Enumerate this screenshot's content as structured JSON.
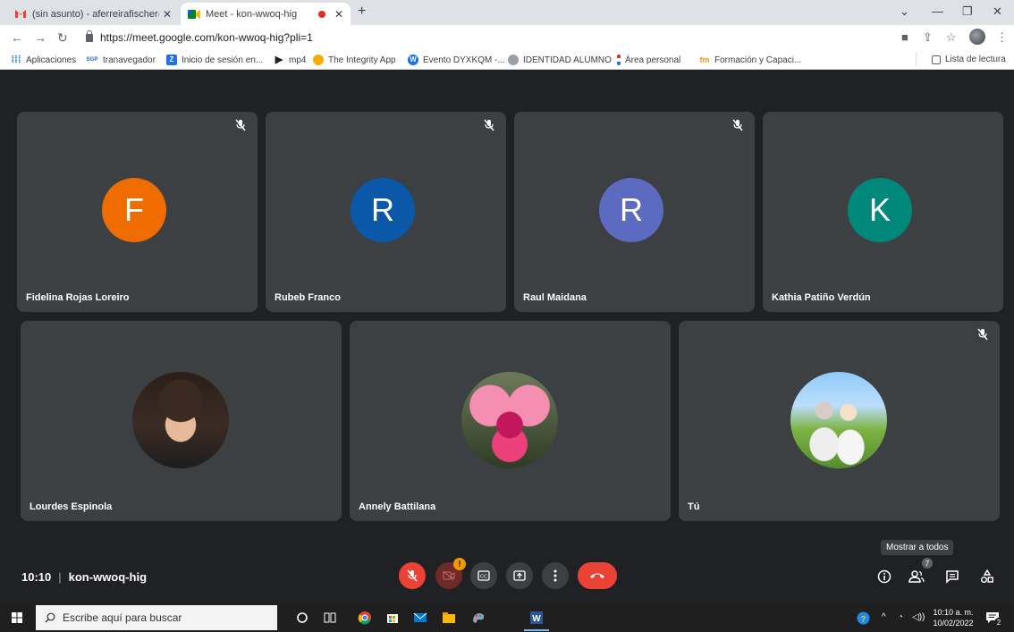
{
  "browser": {
    "tabs": [
      {
        "title": "(sin asunto) - aferreirafischer@gm"
      },
      {
        "title": "Meet - kon-wwoq-hig"
      }
    ],
    "url": "https://meet.google.com/kon-wwoq-hig?pli=1",
    "bookmarks": [
      {
        "label": "Aplicaciones",
        "icon": "apps-grid-icon"
      },
      {
        "label": "tranavegador",
        "icon": "sgp-icon"
      },
      {
        "label": "Inicio de sesión en...",
        "icon": "zoom-icon"
      },
      {
        "label": "mp4",
        "icon": "play-icon"
      },
      {
        "label": "The Integrity App",
        "icon": "integrity-icon"
      },
      {
        "label": "Evento DYXKQM -...",
        "icon": "w-circle-icon"
      },
      {
        "label": "IDENTIDAD ALUMNO",
        "icon": "globe-icon"
      },
      {
        "label": "Área personal",
        "icon": "flag-icon"
      },
      {
        "label": "Formación y Capaci...",
        "icon": "fm-icon"
      }
    ],
    "reading_list": "Lista de lectura"
  },
  "participants": [
    {
      "name": "Fidelina Rojas Loreiro",
      "initial": "F",
      "color": "#ef6c00",
      "muted": true
    },
    {
      "name": "Rubeb Franco",
      "initial": "R",
      "color": "#0b57a8",
      "muted": true
    },
    {
      "name": "Raul Maidana",
      "initial": "R",
      "color": "#5c6bc0",
      "muted": true
    },
    {
      "name": "Kathia Patiño Verdún",
      "initial": "K",
      "color": "#00897b",
      "muted": false
    },
    {
      "name": "Lourdes Espinola",
      "muted": false
    },
    {
      "name": "Annely Battilana",
      "muted": false
    },
    {
      "name": "Tú",
      "muted": true
    }
  ],
  "meeting": {
    "time": "10:10",
    "code": "kon-wwoq-hig",
    "alert_badge": "!",
    "tooltip": "Mostrar a todos",
    "people_count": "7"
  },
  "taskbar": {
    "search_placeholder": "Escribe aquí para buscar",
    "time": "10:10 a. m.",
    "date": "10/02/2022",
    "notif_count": "2"
  }
}
